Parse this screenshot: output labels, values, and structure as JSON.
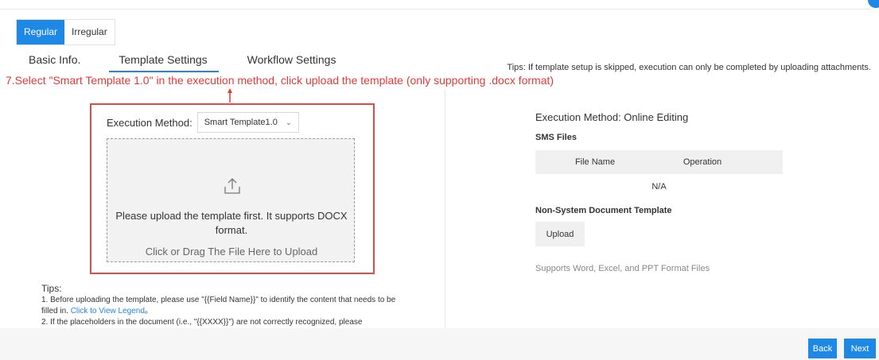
{
  "mode_switch": {
    "regular": "Regular",
    "irregular": "Irregular"
  },
  "tabs": [
    {
      "label": "Basic Info."
    },
    {
      "label": "Template Settings"
    },
    {
      "label": "Workflow Settings"
    }
  ],
  "tips_top": "Tips: If template setup is skipped, execution can only be completed by uploading attachments.",
  "annotation": "7.Select \"Smart Template 1.0\" in the execution method, click upload the template (only supporting .docx format)",
  "left": {
    "execution_label": "Execution Method:",
    "execution_value": "Smart Template1.0",
    "upload_message": "Please upload the template first. It supports DOCX format.",
    "upload_hint": "Click or Drag The File Here to Upload",
    "tips_title": "Tips:",
    "tip1_text": "1. Before uploading the template, please use \"{{Field Name}}\" to identify the content that needs to be filled in. ",
    "tip1_link": "Click to View Legend",
    "tip1_end": "。",
    "tip2_text": "2. If the placeholders in the document (i.e., \"{{XXXX}}\") are not correctly recognized, please"
  },
  "right": {
    "execution_method": "Execution Method: Online Editing",
    "sms_title": "SMS Files",
    "col_file_name": "File Name",
    "col_operation": "Operation",
    "empty": "N/A",
    "nsd_title": "Non-System Document Template",
    "upload_button": "Upload",
    "supports": "Supports Word, Excel, and PPT Format Files"
  },
  "footer": {
    "back": "Back",
    "next": "Next"
  },
  "colors": {
    "accent": "#1e88e5",
    "annotation": "#e53935",
    "highlight_border": "#e04a4a"
  }
}
